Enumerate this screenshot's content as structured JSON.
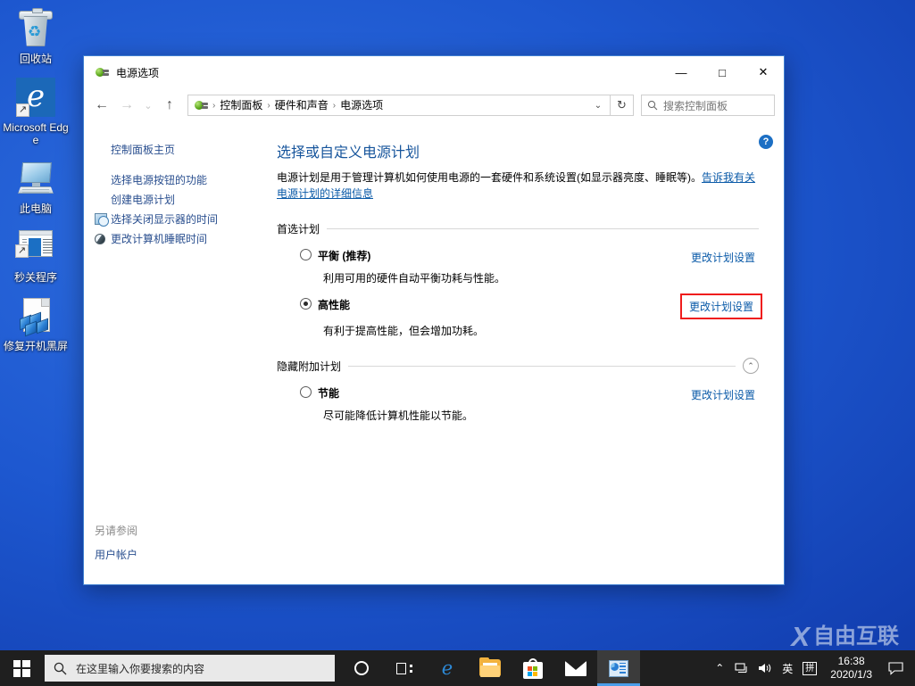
{
  "desktop": {
    "icons": [
      {
        "label": "回收站",
        "icon": "recycle-bin-icon"
      },
      {
        "label": "Microsoft Edge",
        "icon": "microsoft-edge-icon"
      },
      {
        "label": "此电脑",
        "icon": "this-pc-icon"
      },
      {
        "label": "秒关程序",
        "icon": "application-shortcut-icon"
      },
      {
        "label": "修复开机黑屏",
        "icon": "document-cubes-icon"
      }
    ]
  },
  "window": {
    "title": "电源选项",
    "title_icon": "power-plug-icon",
    "buttons": {
      "minimize": "—",
      "maximize": "□",
      "close": "✕"
    },
    "nav": {
      "back": "←",
      "forward": "→",
      "recent": "⌄",
      "up": "↑",
      "refresh": "↻",
      "dropdown": "⌄"
    },
    "breadcrumbs": [
      "控制面板",
      "硬件和声音",
      "电源选项"
    ],
    "breadcrumb_separator": "›",
    "search": {
      "placeholder": "搜索控制面板",
      "icon": "search-icon"
    },
    "help": {
      "label": "?",
      "name": "help-icon"
    }
  },
  "sidebar": {
    "items": [
      {
        "label": "控制面板主页",
        "icon": null
      },
      {
        "label": "选择电源按钮的功能",
        "icon": null
      },
      {
        "label": "创建电源计划",
        "icon": null
      },
      {
        "label": "选择关闭显示器的时间",
        "icon": "clock-icon"
      },
      {
        "label": "更改计算机睡眠时间",
        "icon": "moon-icon"
      }
    ],
    "see_also": {
      "title": "另请参阅",
      "links": [
        "用户帐户"
      ]
    }
  },
  "main": {
    "page_title": "选择或自定义电源计划",
    "description_text": "电源计划是用于管理计算机如何使用电源的一套硬件和系统设置(如显示器亮度、睡眠等)。",
    "description_link": "告诉我有关电源计划的详细信息",
    "groups": [
      {
        "title": "首选计划",
        "collapsible": false,
        "collapse_glyph": "",
        "plans": [
          {
            "name": "平衡 (推荐)",
            "desc": "利用可用的硬件自动平衡功耗与性能。",
            "selected": false,
            "change_label": "更改计划设置",
            "highlighted": false
          },
          {
            "name": "高性能",
            "desc": "有利于提高性能，但会增加功耗。",
            "selected": true,
            "change_label": "更改计划设置",
            "highlighted": true
          }
        ]
      },
      {
        "title": "隐藏附加计划",
        "collapsible": true,
        "collapse_glyph": "⌃",
        "plans": [
          {
            "name": "节能",
            "desc": "尽可能降低计算机性能以节能。",
            "selected": false,
            "change_label": "更改计划设置",
            "highlighted": false
          }
        ]
      }
    ]
  },
  "taskbar": {
    "start": {
      "name": "start-button",
      "icon": "windows-logo-icon"
    },
    "search": {
      "placeholder": "在这里输入你要搜索的内容",
      "icon": "search-icon"
    },
    "items": [
      {
        "name": "cortana-icon",
        "active": false
      },
      {
        "name": "task-view-icon",
        "active": false
      },
      {
        "name": "microsoft-edge-icon",
        "active": false
      },
      {
        "name": "file-explorer-icon",
        "active": false
      },
      {
        "name": "microsoft-store-icon",
        "active": false
      },
      {
        "name": "mail-icon",
        "active": false
      },
      {
        "name": "control-panel-icon",
        "active": true
      }
    ],
    "tray": {
      "expand": "⌃",
      "network": "network-icon",
      "volume": "volume-icon",
      "ime_language": "英",
      "ime_mode": "拼",
      "time": "16:38",
      "date": "2020/1/3",
      "action_center": "action-center-icon"
    }
  },
  "watermark": {
    "logo": "X",
    "text": "自由互联"
  },
  "colors": {
    "desktop_blue": "#1d57cf",
    "accent_link": "#0a5aa8",
    "title_blue": "#17559c",
    "highlight_red": "#ef1c1c",
    "taskbar": "#1f1f1f"
  }
}
